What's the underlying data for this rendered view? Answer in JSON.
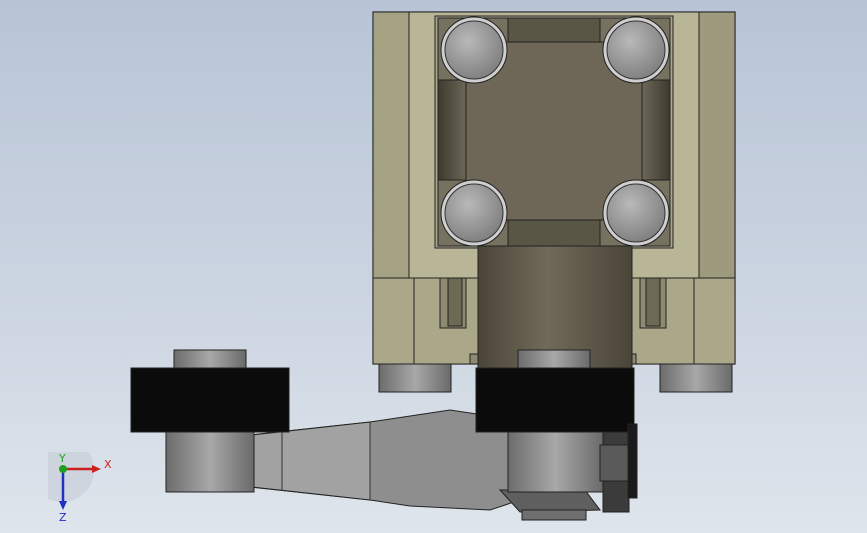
{
  "viewport": {
    "description_colors": {
      "background_top": "#b8c4d6",
      "background_bottom": "#dfe5ec",
      "body_light": "#b5b394",
      "body_mid": "#8f8c70",
      "body_dark": "#6e6a57",
      "roller_black": "#0a0a0a",
      "steel": "#8e8e8e"
    }
  },
  "triad": {
    "x_label": "X",
    "y_label": "Y",
    "z_label": "Z",
    "x_color": "#cc2020",
    "y_color": "#20a020",
    "z_color": "#2030c0"
  }
}
